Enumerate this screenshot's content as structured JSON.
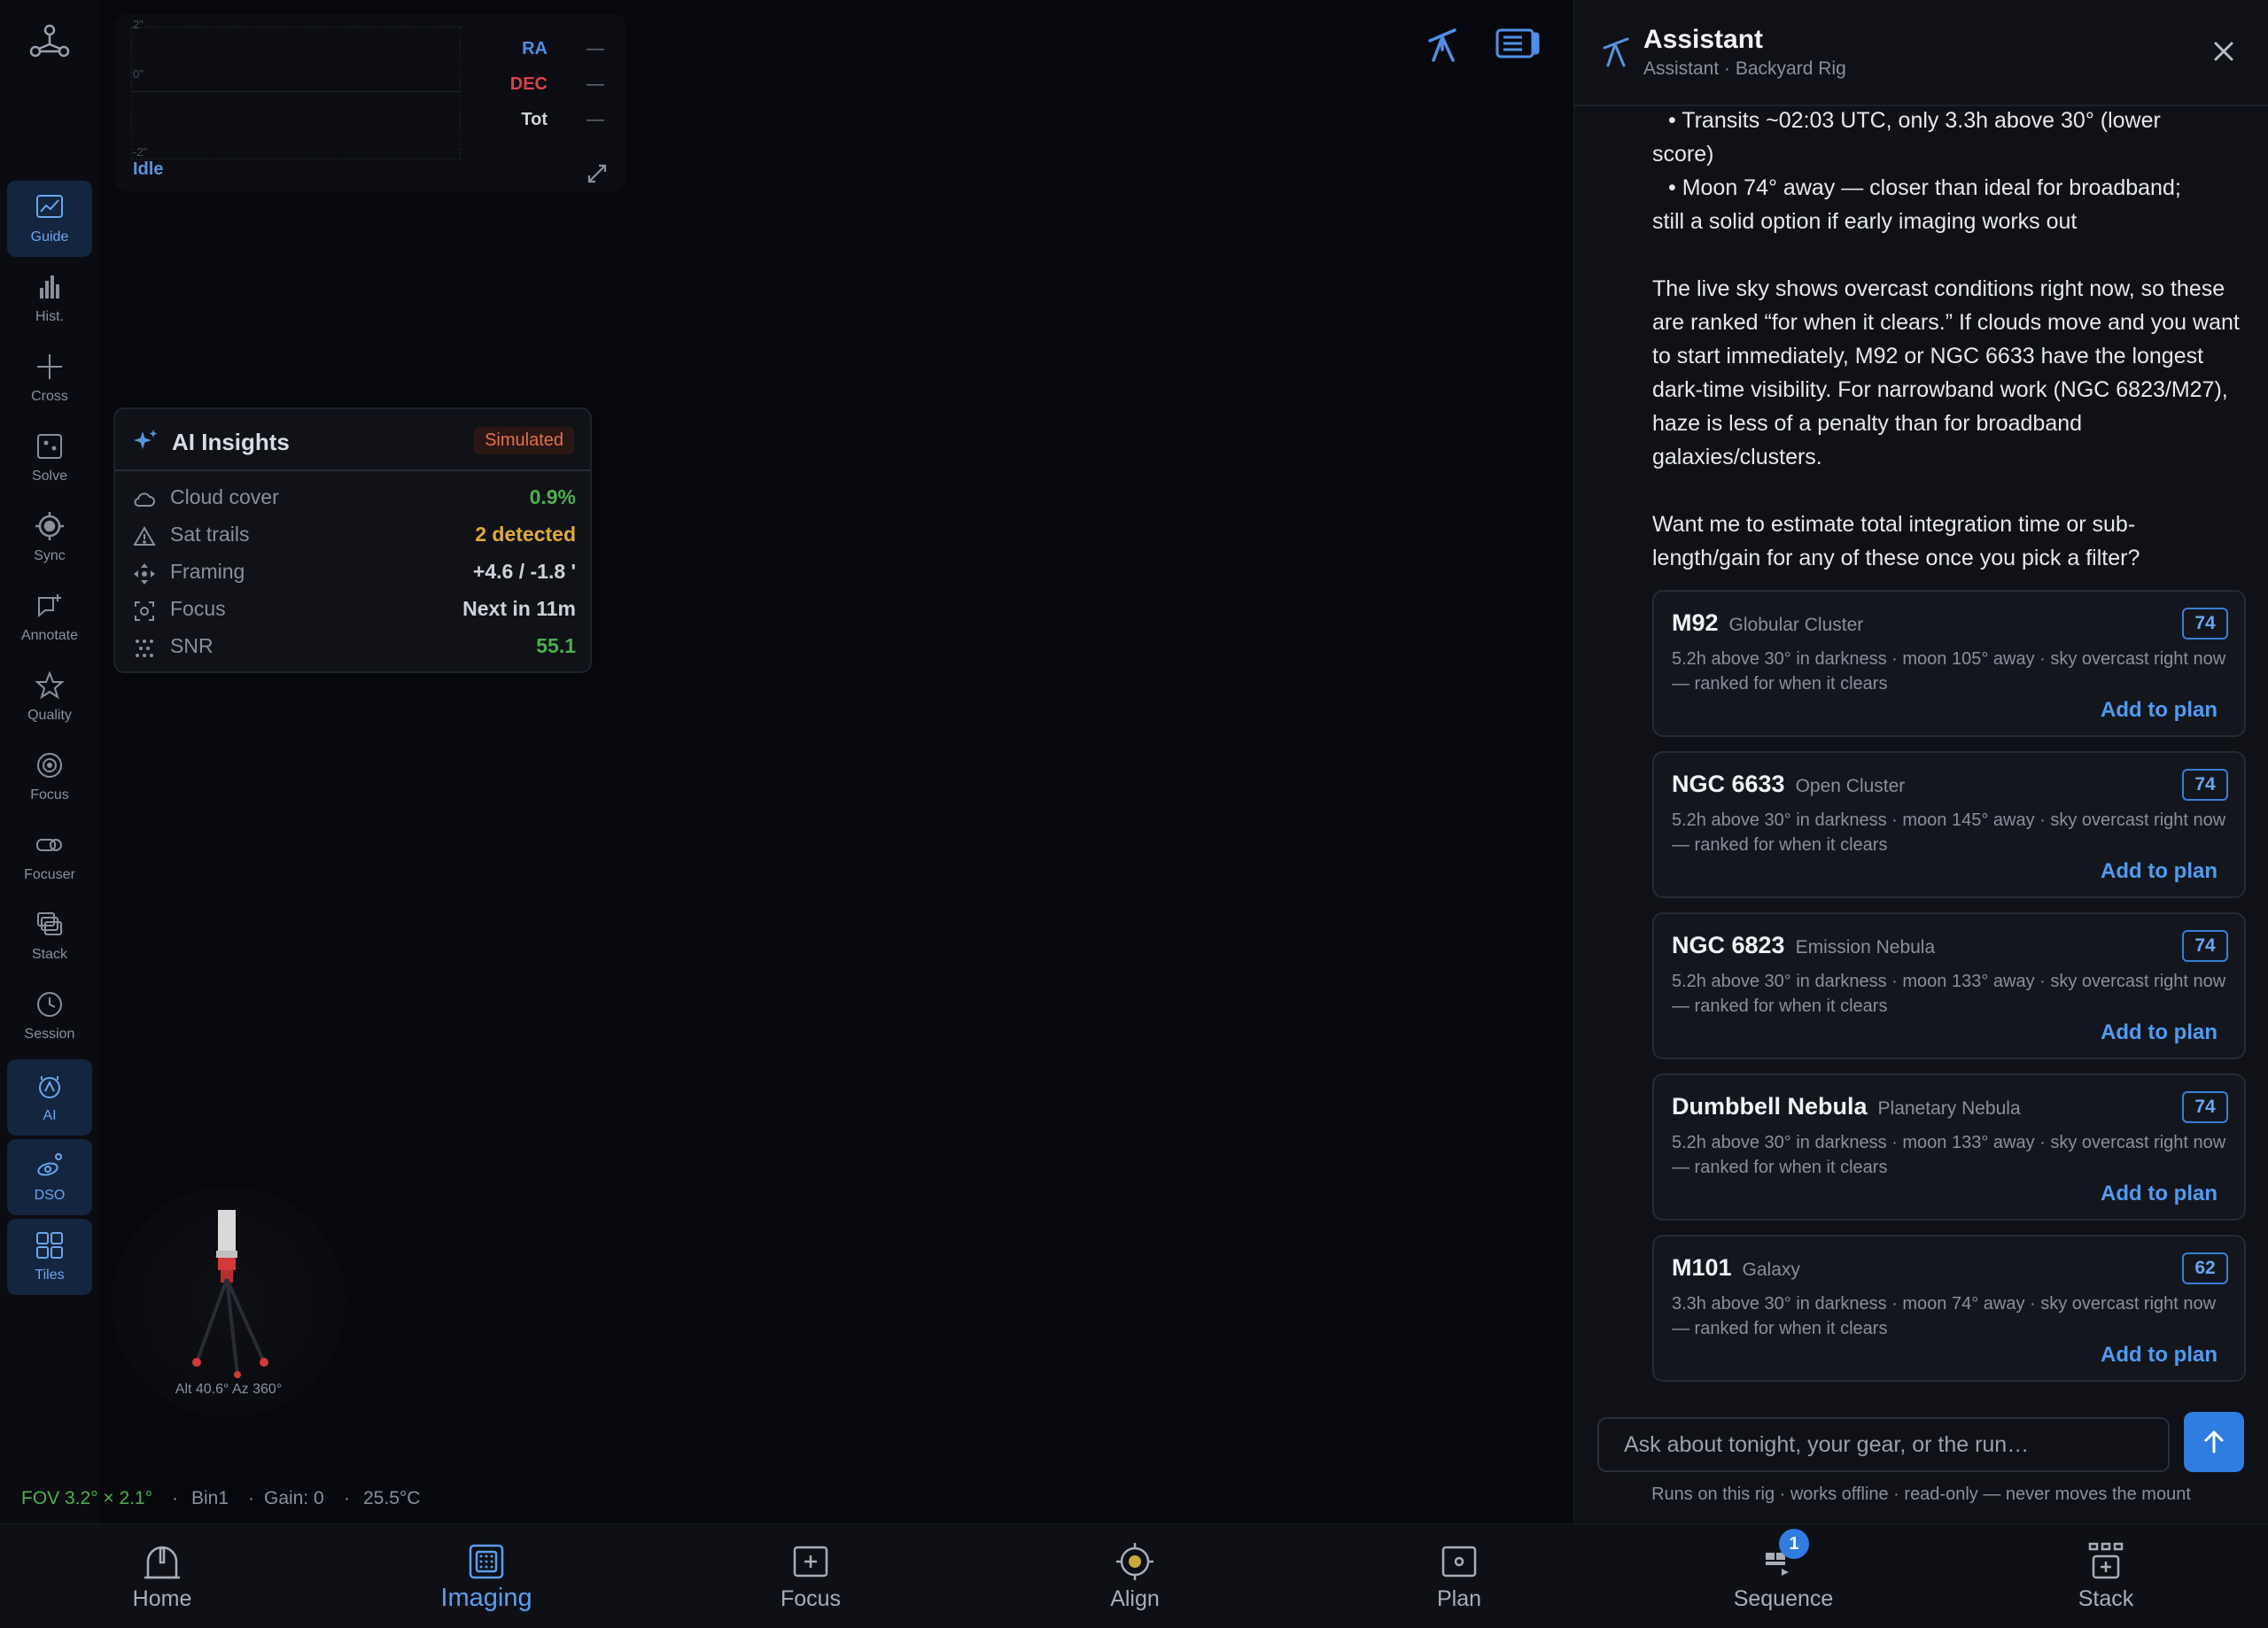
{
  "sidebar": {
    "items": [
      {
        "label": "Guide",
        "icon": "chart-line-icon",
        "active": true
      },
      {
        "label": "Hist.",
        "icon": "histogram-icon",
        "active": false
      },
      {
        "label": "Cross",
        "icon": "crosshair-icon",
        "active": false
      },
      {
        "label": "Solve",
        "icon": "plate-solve-icon",
        "active": false
      },
      {
        "label": "Sync",
        "icon": "sync-target-icon",
        "active": false
      },
      {
        "label": "Annotate",
        "icon": "annotate-icon",
        "active": false
      },
      {
        "label": "Quality",
        "icon": "star-icon",
        "active": false
      },
      {
        "label": "Focus",
        "icon": "focus-ring-icon",
        "active": false
      },
      {
        "label": "Focuser",
        "icon": "focuser-icon",
        "active": false
      },
      {
        "label": "Stack",
        "icon": "stack-icon",
        "active": false
      },
      {
        "label": "Session",
        "icon": "clock-icon",
        "active": false
      },
      {
        "label": "AI",
        "icon": "ai-icon",
        "active": true
      },
      {
        "label": "DSO",
        "icon": "galaxy-icon",
        "active": true
      },
      {
        "label": "Tiles",
        "icon": "tiles-icon",
        "active": true
      }
    ]
  },
  "guide_graph": {
    "y_top": "2\"",
    "y_mid": "0\"",
    "y_bottom": "-2\"",
    "legend": [
      {
        "name": "RA",
        "value": "—",
        "color": "#4f8fe6"
      },
      {
        "name": "DEC",
        "value": "—",
        "color": "#d9434a"
      },
      {
        "name": "Tot",
        "value": "—",
        "color": "#cfd2d8"
      }
    ],
    "status": "Idle"
  },
  "insights": {
    "title": "AI Insights",
    "badge": "Simulated",
    "rows": [
      {
        "label": "Cloud cover",
        "value": "0.9%",
        "color": "#4caf50",
        "icon": "cloud-icon"
      },
      {
        "label": "Sat trails",
        "value": "2 detected",
        "color": "#e0a93a",
        "icon": "warning-icon"
      },
      {
        "label": "Framing",
        "value": "+4.6 / -1.8 '",
        "color": "#cfd2d8",
        "icon": "move-icon"
      },
      {
        "label": "Focus",
        "value": "Next in 11m",
        "color": "#cfd2d8",
        "icon": "focus-frame-icon"
      },
      {
        "label": "SNR",
        "value": "55.1",
        "color": "#4caf50",
        "icon": "noise-icon"
      }
    ]
  },
  "mount": {
    "readout": "Alt 40.6° Az 360°"
  },
  "status_bar": {
    "fov": "FOV 3.2° × 2.1°",
    "sep": "·",
    "bin": "Bin1",
    "gain": "Gain: 0",
    "temp": "25.5°C"
  },
  "bottom_nav": [
    {
      "label": "Home",
      "icon": "observatory-icon",
      "active": false
    },
    {
      "label": "Imaging",
      "icon": "camera-sensor-icon",
      "active": true
    },
    {
      "label": "Focus",
      "icon": "focus-target-icon",
      "active": false
    },
    {
      "label": "Align",
      "icon": "align-reticle-icon",
      "active": false
    },
    {
      "label": "Plan",
      "icon": "plan-frame-icon",
      "active": false
    },
    {
      "label": "Sequence",
      "icon": "sequence-icon",
      "active": false,
      "badge": "1"
    },
    {
      "label": "Stack",
      "icon": "stack-add-icon",
      "active": false
    }
  ],
  "assistant": {
    "title": "Assistant",
    "subtitle": "Assistant · Backyard Rig",
    "bullets_1": "• Transits ~02:03 UTC, only 3.3h above 30° (lower",
    "bullets_1b": "score)",
    "bullets_2": "• Moon 74° away — closer than ideal for broadband;",
    "bullets_2b": "still a solid option if early imaging works out",
    "paragraph_1": "The live sky shows overcast conditions right now, so these are ranked “for when it clears.” If clouds move and you want to start immediately, M92 or NGC 6633 have the longest dark-time visibility. For narrowband work (NGC 6823/M27), haze is less of a penalty than for broadband galaxies/clusters.",
    "paragraph_2": "Want me to estimate total integration time or sub-length/gain for any of these once you pick a filter?",
    "add_label": "Add to plan",
    "cards": [
      {
        "name": "M92",
        "type": "Globular Cluster",
        "score": "74",
        "desc": "5.2h above 30° in darkness · moon 105° away · sky overcast right now — ranked for when it clears"
      },
      {
        "name": "NGC 6633",
        "type": "Open Cluster",
        "score": "74",
        "desc": "5.2h above 30° in darkness · moon 145° away · sky overcast right now — ranked for when it clears"
      },
      {
        "name": "NGC 6823",
        "type": "Emission Nebula",
        "score": "74",
        "desc": "5.2h above 30° in darkness · moon 133° away · sky overcast right now — ranked for when it clears"
      },
      {
        "name": "Dumbbell Nebula",
        "type": "Planetary Nebula",
        "score": "74",
        "desc": "5.2h above 30° in darkness · moon 133° away · sky overcast right now — ranked for when it clears"
      },
      {
        "name": "M101",
        "type": "Galaxy",
        "score": "62",
        "desc": "3.3h above 30° in darkness · moon 74° away · sky overcast right now — ranked for when it clears"
      }
    ],
    "input_placeholder": "Ask about tonight, your gear, or the run…",
    "footnote": "Runs on this rig · works offline · read-only — never moves the mount"
  },
  "colors": {
    "accent": "#2f7de0",
    "background": "#07080d",
    "panel": "#0f1117"
  }
}
